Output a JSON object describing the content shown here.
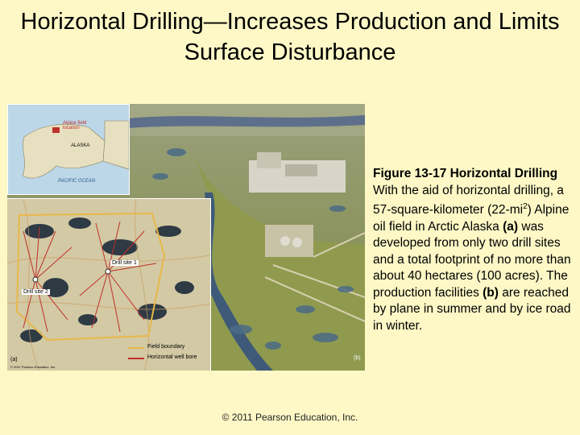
{
  "slide": {
    "title": "Horizontal Drilling—Increases Production and Limits Surface Disturbance",
    "copyright": "© 2011 Pearson Education, Inc."
  },
  "figure": {
    "inset_labels": {
      "location": "Alpine field location",
      "region": "ALASKA",
      "ocean": "PACIFIC OCEAN"
    },
    "map_labels": {
      "drill_site_2": "Drill site 2",
      "drill_site_1": "Drill site 1",
      "panel_a": "(a)",
      "credit": "© 2011 Pearson Education, Inc."
    },
    "legend": [
      {
        "label": "Field boundary",
        "color": "#e8b84a"
      },
      {
        "label": "Horizontal well bore",
        "color": "#c0302a"
      }
    ],
    "panel_b": "(b)"
  },
  "caption": {
    "title": "Figure 13-17  Horizontal Drilling",
    "text_1": "With the aid of horizontal drilling, a 57-square-kilometer (22-mi",
    "sup": "2",
    "text_2": ") Alpine oil field in Arctic Alaska ",
    "ref_a": "(a)",
    "text_3": " was developed from only two drill sites and a total footprint of no more than about 40 hectares (100 acres). The production facilities ",
    "ref_b": "(b)",
    "text_4": " are reached by plane in summer and by ice road in winter."
  }
}
